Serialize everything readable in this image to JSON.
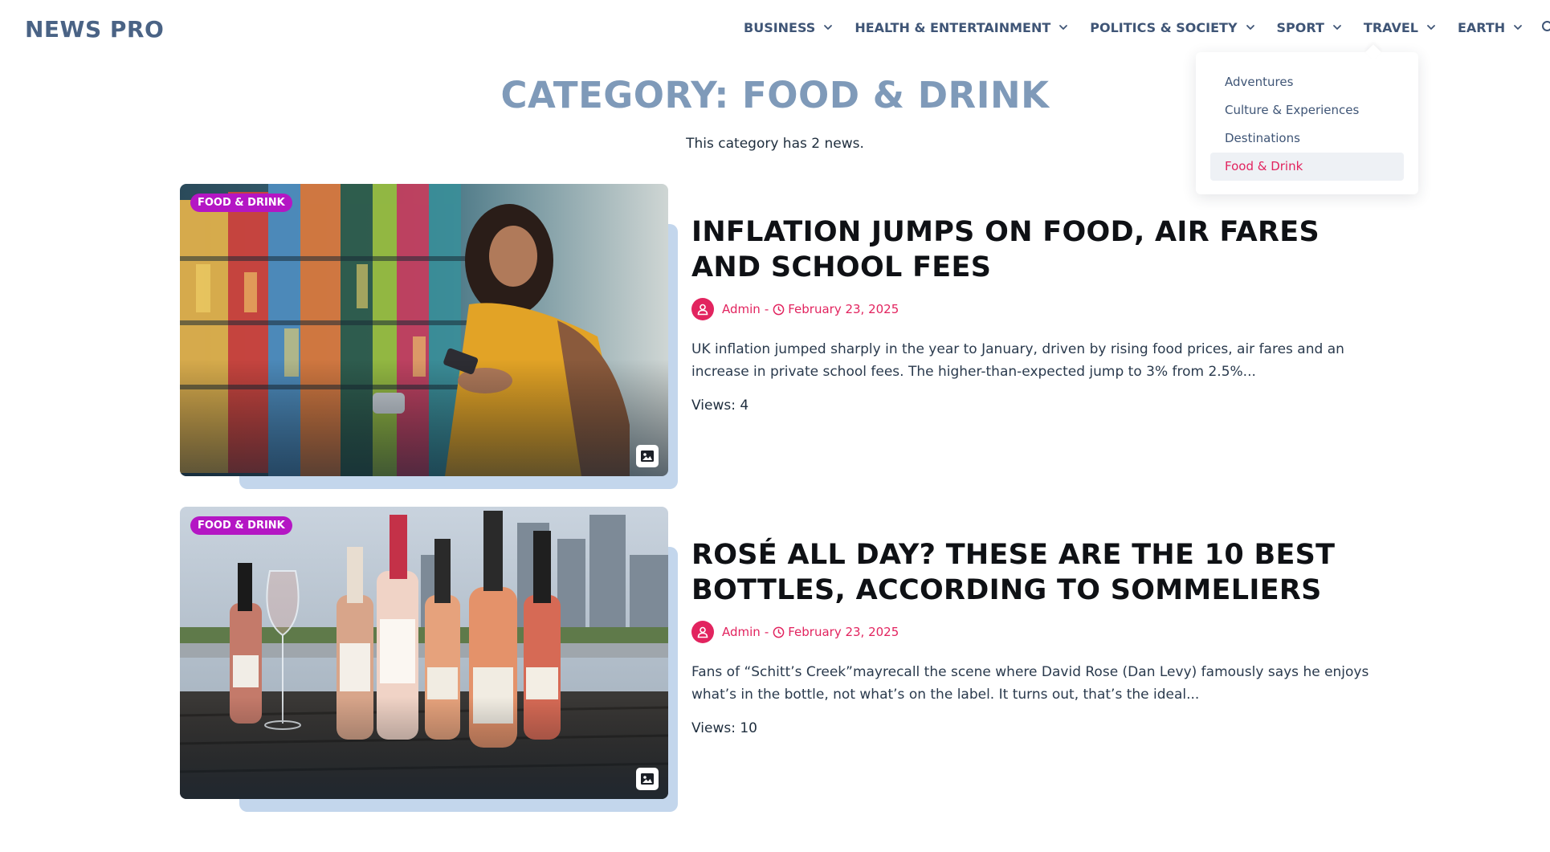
{
  "header": {
    "logo": "NEWS PRO",
    "nav": [
      {
        "label": "BUSINESS"
      },
      {
        "label": "HEALTH & ENTERTAINMENT"
      },
      {
        "label": "POLITICS & SOCIETY"
      },
      {
        "label": "SPORT"
      },
      {
        "label": "TRAVEL"
      },
      {
        "label": "EARTH"
      }
    ]
  },
  "dropdown": {
    "items": [
      {
        "label": "Adventures"
      },
      {
        "label": "Culture & Experiences"
      },
      {
        "label": "Destinations"
      },
      {
        "label": "Food & Drink"
      }
    ],
    "active_label": "Food & Drink"
  },
  "page": {
    "title": "CATEGORY: FOOD & DRINK",
    "subtitle": "This category has 2 news."
  },
  "articles": [
    {
      "category": "FOOD & DRINK",
      "title": "INFLATION JUMPS ON FOOD, AIR FARES AND SCHOOL FEES",
      "author": "Admin",
      "separator": "-",
      "date": "February 23, 2025",
      "excerpt": "UK inflation jumped sharply in the year to January, driven by rising food prices, air fares and an increase in private school fees. The higher-than-expected jump to 3% from 2.5%...",
      "views": "Views: 4"
    },
    {
      "category": "FOOD & DRINK",
      "title": "ROSÉ ALL DAY? THESE ARE THE 10 BEST BOTTLES, ACCORDING TO SOMMELIERS",
      "author": "Admin",
      "separator": "-",
      "date": "February 23, 2025",
      "excerpt": "Fans of “Schitt’s Creek”mayrecall the scene where David Rose (Dan Levy) famously says he enjoys what’s in the bottle, not what’s on the label. It turns out, that’s the ideal...",
      "views": "Views: 10"
    }
  ],
  "colors": {
    "logo": "#4a6385",
    "nav": "#3f5576",
    "accent": "#e2245f",
    "badge": "#b416c4",
    "page_title": "#7f9ab9",
    "thumb_shadow": "#c3d6ec"
  },
  "icons": {
    "nav_chevron": "chevron-down-icon",
    "search": "search-icon",
    "author": "user-icon",
    "date": "clock-icon",
    "image": "image-icon"
  }
}
